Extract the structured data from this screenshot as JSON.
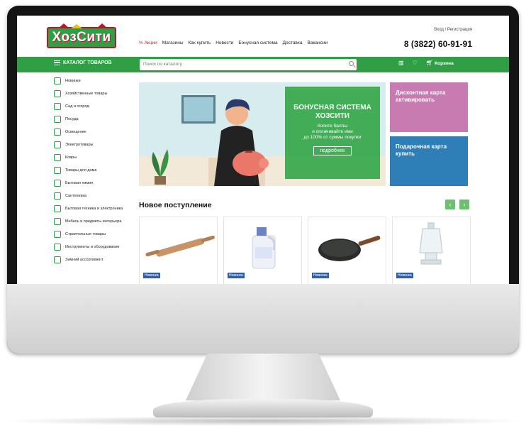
{
  "header": {
    "logo_text": "ХозСити",
    "login_text": "Вход / Регистрация",
    "phone": "8 (3822) 60-91-91",
    "nav": [
      {
        "label": "% Акции",
        "highlight": true
      },
      {
        "label": "Магазины"
      },
      {
        "label": "Как купить"
      },
      {
        "label": "Новости"
      },
      {
        "label": "Бонусная система"
      },
      {
        "label": "Доставка"
      },
      {
        "label": "Вакансии"
      }
    ]
  },
  "toolbar": {
    "catalog_label": "КАТАЛОГ ТОВАРОВ",
    "search_placeholder": "Поиск по каталогу",
    "cart_label": "Корзина"
  },
  "sidebar": {
    "items": [
      {
        "label": "Новинки",
        "icon": "star-icon"
      },
      {
        "label": "Хозяйственные товары",
        "icon": "box-icon"
      },
      {
        "label": "Сад и огород",
        "icon": "plant-icon"
      },
      {
        "label": "Посуда",
        "icon": "pot-icon"
      },
      {
        "label": "Освещение",
        "icon": "lamp-icon"
      },
      {
        "label": "Электротовары",
        "icon": "bulb-icon"
      },
      {
        "label": "Ковры",
        "icon": "rug-icon"
      },
      {
        "label": "Товары для дома",
        "icon": "home-icon"
      },
      {
        "label": "Бытовая химия",
        "icon": "bottle-icon"
      },
      {
        "label": "Сантехника",
        "icon": "faucet-icon"
      },
      {
        "label": "Бытовая техника и электроника",
        "icon": "washer-icon"
      },
      {
        "label": "Мебель и предметы интерьера",
        "icon": "sofa-icon"
      },
      {
        "label": "Строительные товары",
        "icon": "trowel-icon"
      },
      {
        "label": "Инструменты и оборудование",
        "icon": "drill-icon"
      },
      {
        "label": "Зимний ассортимент",
        "icon": "snow-icon"
      }
    ]
  },
  "banner": {
    "title_line1": "БОНУСНАЯ СИСТЕМА",
    "title_line2": "ХОЗСИТИ",
    "text_line1": "Копите баллы",
    "text_line2": "и оплачивайте ими",
    "text_line3": "до 100% от суммы покупки",
    "button_label": "подробнее"
  },
  "promos": [
    {
      "line1": "Дисконтная карта",
      "line2": "активировать"
    },
    {
      "line1": "Подарочная карта",
      "line2": "купить"
    }
  ],
  "new_arrivals": {
    "title": "Новое поступление",
    "prev": "‹",
    "next": "›",
    "products": [
      {
        "badge": "Новинка"
      },
      {
        "badge": "Новинка"
      },
      {
        "badge": "Новинка"
      },
      {
        "badge": "Новинка"
      }
    ]
  },
  "colors": {
    "brand_green": "#2f9e44",
    "accent_red": "#d21c1c",
    "promo_pink": "#c77bb0",
    "promo_blue": "#2e7fb7",
    "badge_blue": "#2b5fb3"
  }
}
